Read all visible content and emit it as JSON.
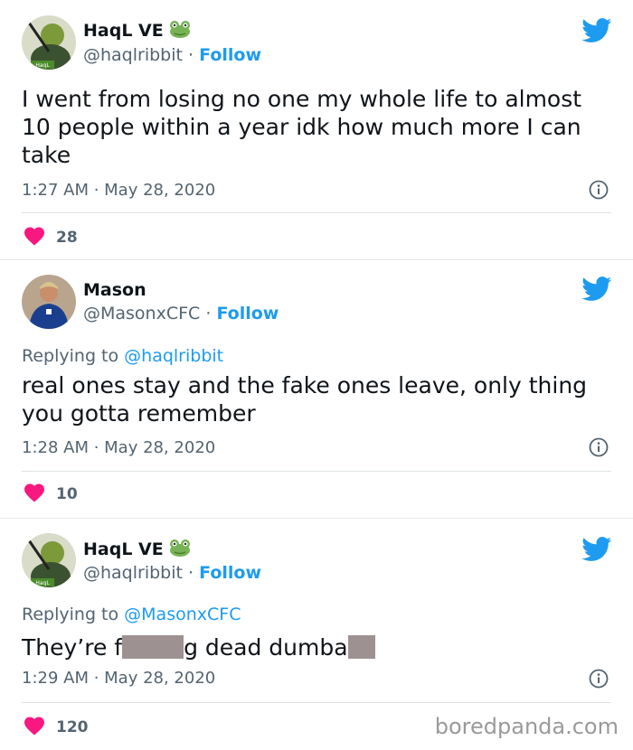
{
  "tweets": [
    {
      "name": "HaqL VE",
      "handle": "@haqlribbit",
      "dot": "·",
      "follow": "Follow",
      "reply_prefix": "",
      "reply_handle": "",
      "text": "I went from losing no one my whole life to almost 10 people within a year idk how much more I can take",
      "time": "1:27 AM · May 28, 2020",
      "likes": "28",
      "avatar_caption": "HaqL"
    },
    {
      "name": "Mason",
      "handle": "@MasonxCFC",
      "dot": "·",
      "follow": "Follow",
      "reply_prefix": "Replying to ",
      "reply_handle": "@haqlribbit",
      "text": "real ones stay and the fake ones leave, only thing you gotta remember",
      "time": "1:28 AM · May 28, 2020",
      "likes": "10"
    },
    {
      "name": "HaqL VE",
      "handle": "@haqlribbit",
      "dot": "·",
      "follow": "Follow",
      "reply_prefix": "Replying to ",
      "reply_handle": "@MasonxCFC",
      "text_part1": "They’re f",
      "text_part2": "g dead dumba",
      "time": "1:29 AM · May 28, 2020",
      "likes": "120",
      "avatar_caption": "HaqL"
    }
  ],
  "watermark": "boredpanda.com",
  "colors": {
    "like": "#f91880",
    "twitter_blue": "#1d9bf0",
    "redaction": "#9e9191"
  },
  "icons": [
    "frog-emoji-icon",
    "twitter-bird-icon",
    "info-icon",
    "heart-icon"
  ]
}
